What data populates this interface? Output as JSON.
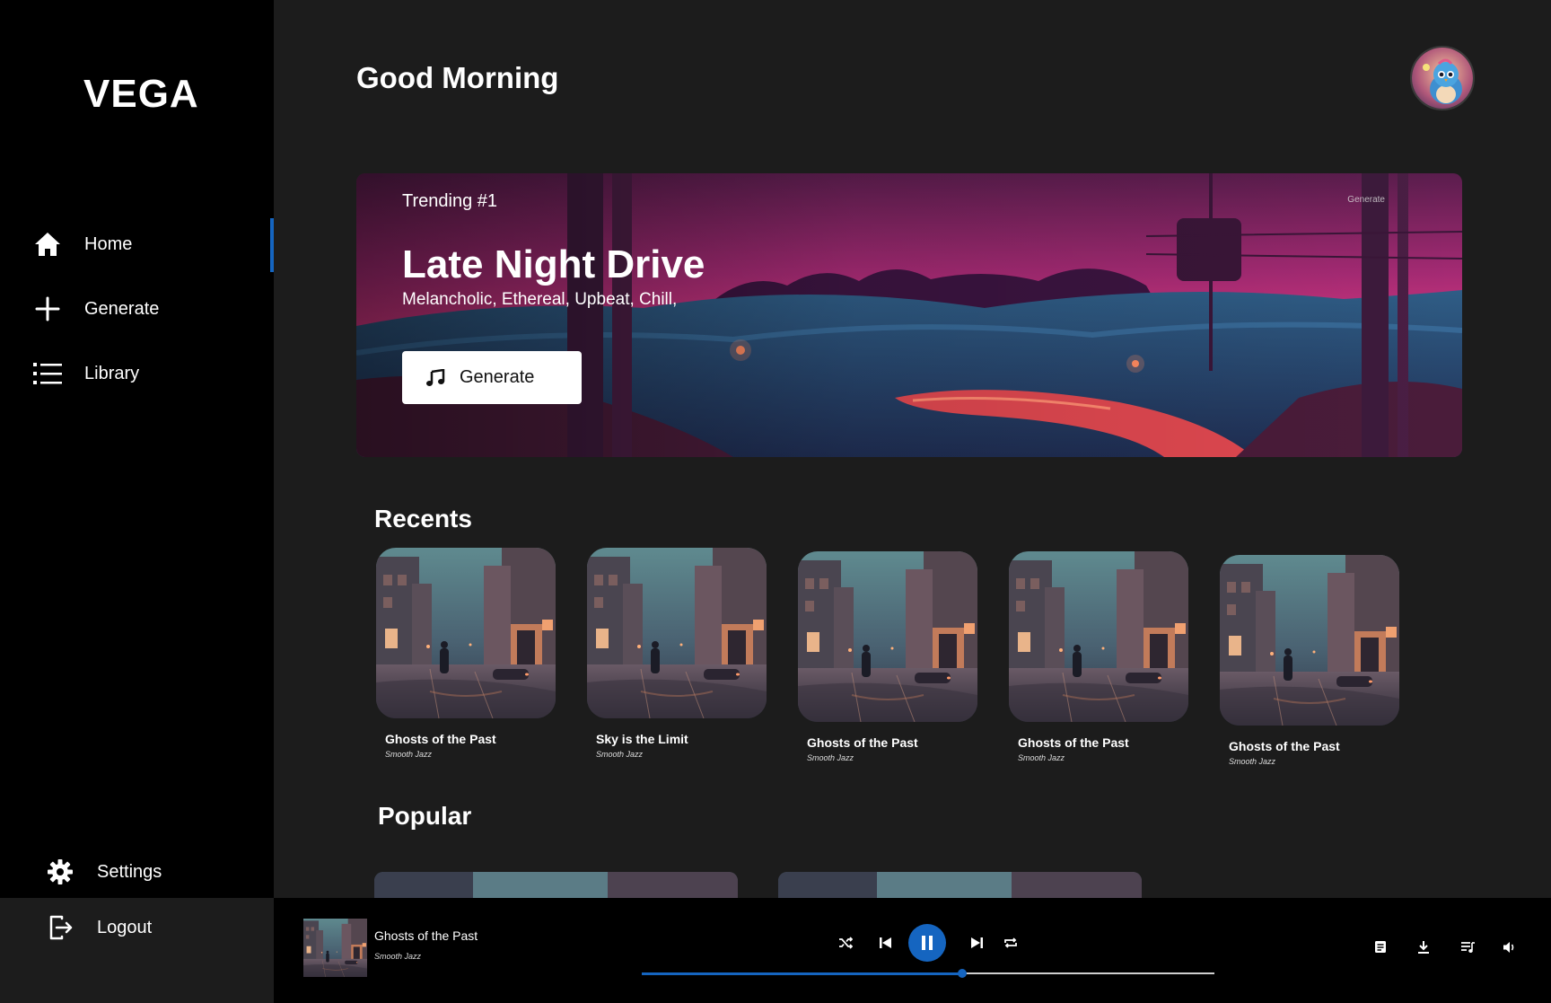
{
  "sidebar": {
    "logo": "VEGA",
    "items": [
      {
        "label": "Home",
        "icon": "home-icon"
      },
      {
        "label": "Generate",
        "icon": "plus-icon"
      },
      {
        "label": "Library",
        "icon": "list-icon"
      }
    ],
    "settings_label": "Settings",
    "logout_label": "Logout"
  },
  "header": {
    "greeting": "Good Morning"
  },
  "hero": {
    "tag": "Trending #1",
    "corner_label": "Generate",
    "title": "Late Night Drive",
    "tags": "Melancholic, Ethereal, Upbeat, Chill,",
    "button_label": "Generate"
  },
  "recents": {
    "title": "Recents",
    "items": [
      {
        "name": "Ghosts of the Past",
        "genre": "Smooth Jazz"
      },
      {
        "name": "Sky is the Limit",
        "genre": "Smooth Jazz"
      },
      {
        "name": "Ghosts of the Past",
        "genre": "Smooth Jazz"
      },
      {
        "name": "Ghosts of the Past",
        "genre": "Smooth Jazz"
      },
      {
        "name": "Ghosts of the Past",
        "genre": "Smooth Jazz"
      }
    ]
  },
  "popular": {
    "title": "Popular"
  },
  "player": {
    "title": "Ghosts of the Past",
    "genre": "Smooth Jazz",
    "progress": 0.56,
    "accent": "#1565c0"
  }
}
